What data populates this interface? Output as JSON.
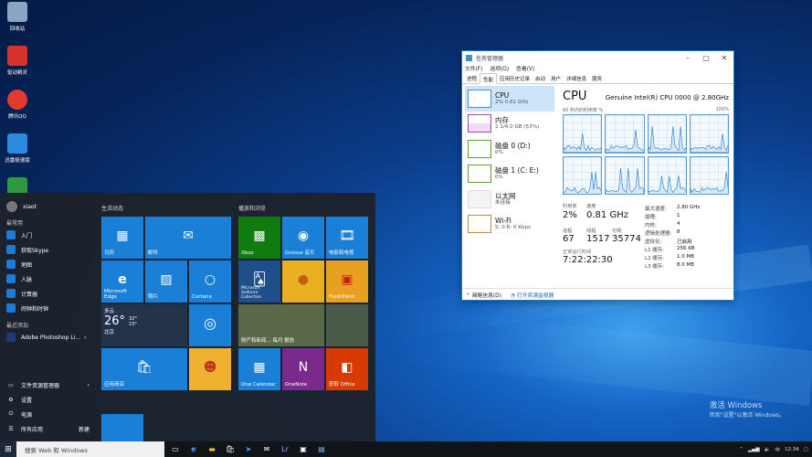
{
  "desktop": {
    "icons": [
      {
        "label": "回收站",
        "icon": "recycle-bin-icon",
        "color": "#8aa4c4"
      },
      {
        "label": "驱动精灵",
        "icon": "driver-genius-icon",
        "color": "#d9322a"
      },
      {
        "label": "腾讯QQ",
        "icon": "qq-icon",
        "color": "#e23b2e"
      },
      {
        "label": "迅雷极速版",
        "icon": "xunlei-icon",
        "color": "#2c8be0"
      },
      {
        "label": "",
        "icon": "app-icon",
        "color": "#2d9a3e"
      }
    ],
    "activation": {
      "line1": "激活 Windows",
      "line2": "转到\"设置\"以激活 Windows。"
    }
  },
  "start_menu": {
    "user": "xiaot",
    "most_used_header": "最常用",
    "most_used": [
      {
        "label": "入门",
        "color": "#1c7bd4"
      },
      {
        "label": "获取Skype",
        "color": "#1c7bd4"
      },
      {
        "label": "地图",
        "color": "#1c7bd4"
      },
      {
        "label": "人脉",
        "color": "#1c7bd4"
      },
      {
        "label": "计算器",
        "color": "#1c7bd4"
      },
      {
        "label": "闹钟和时钟",
        "color": "#1c7bd4"
      }
    ],
    "recent_header": "最近添加",
    "recent": [
      {
        "label": "Adobe Photoshop Li...",
        "color": "#1e3c78"
      }
    ],
    "bottom": [
      {
        "label": "文件资源管理器",
        "color": "#666"
      },
      {
        "label": "设置",
        "color": "#666"
      },
      {
        "label": "电源",
        "color": "#666"
      },
      {
        "label": "所有应用",
        "badge": "新建",
        "color": "#666"
      }
    ],
    "group1_title": "生活动态",
    "group2_title": "播放和浏览",
    "tiles": {
      "calendar": "日历",
      "mail": "邮件",
      "edge": "Microsoft Edge",
      "photos": "照片",
      "cortana": "Cortana",
      "weather": {
        "cond": "多云",
        "temp": "26°",
        "hi": "32°",
        "lo": "23°",
        "city": "北京"
      },
      "store": "应用商店",
      "xbox": "Xbox",
      "groove": "Groove 音乐",
      "movies": "电影和电视",
      "solitaire": "Microsoft Solitaire Collection",
      "freshpaint": "FreshPaint",
      "news": "财产和新闻... 每月 报告",
      "one_calendar": "One Calendar",
      "onenote": "OneNote",
      "office": "获取 Office"
    }
  },
  "taskbar": {
    "search_placeholder": "搜索 Web 和 Windows",
    "clock": "12:34"
  },
  "task_manager": {
    "title": "任务管理器",
    "menu": [
      "文件(F)",
      "选项(O)",
      "查看(V)"
    ],
    "tabs": [
      "进程",
      "性能",
      "应用历史记录",
      "启动",
      "用户",
      "详细信息",
      "服务"
    ],
    "active_tab": "性能",
    "resources": [
      {
        "name": "CPU",
        "value": "2% 0.81 GHz",
        "color": "#4a90c8"
      },
      {
        "name": "内存",
        "value": "2.1/4.0 GB (53%)",
        "color": "#9b4aa8"
      },
      {
        "name": "磁盘 0 (D:)",
        "value": "0%",
        "color": "#5aa02c"
      },
      {
        "name": "磁盘 1 (C: E:)",
        "value": "0%",
        "color": "#5aa02c"
      },
      {
        "name": "以太网",
        "value": "未连接",
        "color": "#aaaaaa"
      },
      {
        "name": "Wi-Fi",
        "value": "S: 0 R: 0 Kbps",
        "color": "#c08a40"
      }
    ],
    "heading": "CPU",
    "model": "Genuine Intel(R) CPU 0000 @ 2.80GHz",
    "graph_caption": "60 秒内的利用率 %",
    "graph_max": "100%",
    "stats": {
      "util_label": "利用率",
      "util": "2%",
      "speed_label": "速度",
      "speed": "0.81 GHz",
      "proc_label": "进程",
      "proc": "67",
      "thread_label": "线程",
      "thread": "1517",
      "handle_label": "句柄",
      "handle": "35774",
      "uptime_label": "正常运行时间",
      "uptime": "7:22:22:30"
    },
    "details": [
      {
        "k": "最大速度:",
        "v": "2.80 GHz"
      },
      {
        "k": "插槽:",
        "v": "1"
      },
      {
        "k": "内核:",
        "v": "4"
      },
      {
        "k": "逻辑处理器:",
        "v": "8"
      },
      {
        "k": "虚拟化:",
        "v": "已启用"
      },
      {
        "k": "L1 缓存:",
        "v": "256 KB"
      },
      {
        "k": "L2 缓存:",
        "v": "1.0 MB"
      },
      {
        "k": "L3 缓存:",
        "v": "8.0 MB"
      }
    ],
    "footer": {
      "brief": "简略信息(D)",
      "monitor": "打开资源监视器"
    }
  }
}
